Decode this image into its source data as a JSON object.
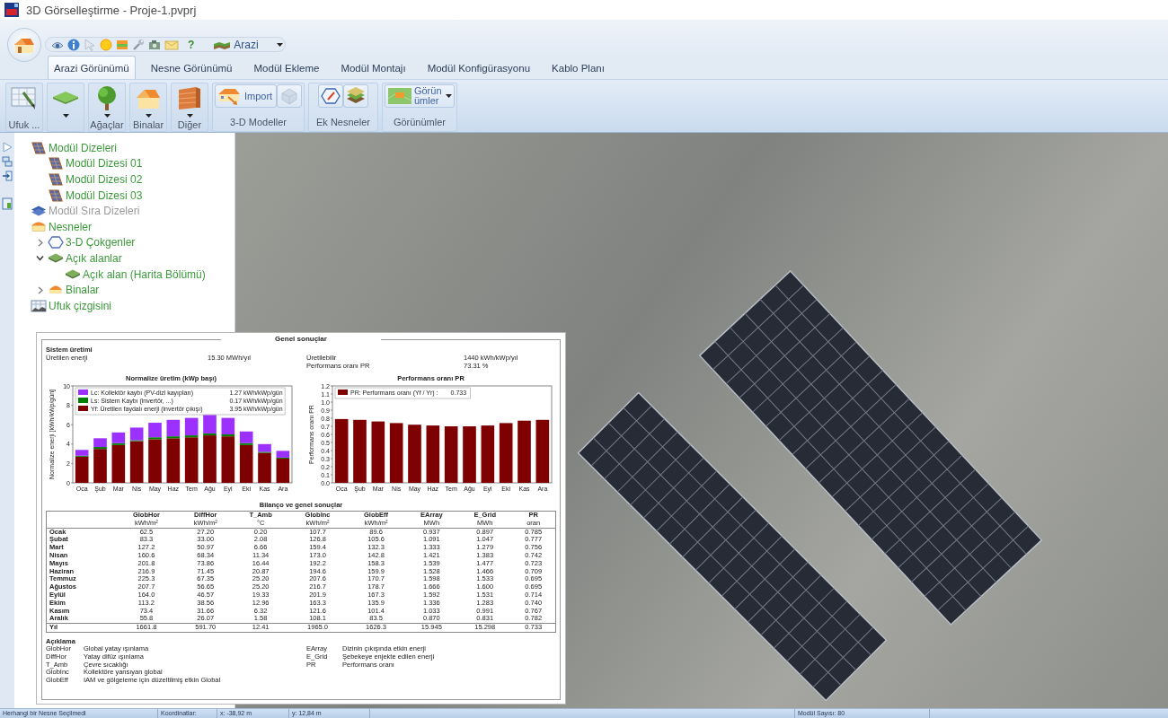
{
  "window": {
    "title": "3D Görselleştirme - Proje-1.pvprj"
  },
  "quick_access": {
    "help": "?",
    "view_dropdown": "Arazi"
  },
  "tabs": [
    {
      "label": "Arazi Görünümü",
      "selected": true
    },
    {
      "label": "Nesne Görünümü",
      "selected": false
    },
    {
      "label": "Modül Ekleme",
      "selected": false
    },
    {
      "label": "Modül Montajı",
      "selected": false
    },
    {
      "label": "Modül Konfigürasyonu",
      "selected": false
    },
    {
      "label": "Kablo Planı",
      "selected": false
    }
  ],
  "ribbon": {
    "buttons": [
      {
        "kind": "horizon",
        "label": "Ufuk ...",
        "dropdown": false
      },
      {
        "kind": "ground",
        "dropdown": true
      },
      {
        "kind": "tree",
        "label": "Ağaçlar",
        "dropdown": true
      },
      {
        "kind": "house",
        "label": "Binalar",
        "dropdown": true
      },
      {
        "kind": "wall",
        "label": "Diğer",
        "dropdown": true
      }
    ],
    "groups": [
      {
        "label": "3-D Modeller",
        "buttons": [
          {
            "kind": "import",
            "label": "Import",
            "disabled": false,
            "dropdown": false
          },
          {
            "kind": "mesh",
            "disabled": true,
            "dropdown": false
          }
        ]
      },
      {
        "label": "Ek Nesneler",
        "buttons": [
          {
            "kind": "polygon",
            "disabled": false,
            "dropdown": false
          },
          {
            "kind": "layers",
            "disabled": false,
            "dropdown": false
          }
        ]
      },
      {
        "label": "Görünümler",
        "buttons": [
          {
            "kind": "views",
            "label": "Görünümler",
            "disabled": false,
            "dropdown": true
          }
        ]
      }
    ]
  },
  "tree": [
    {
      "kind": "modules",
      "label": "Modül Dizeleri",
      "disabled": false,
      "children": [
        {
          "kind": "modules",
          "label": "Modül Dizesi 01",
          "disabled": false
        },
        {
          "kind": "modules",
          "label": "Modül Dizesi 02",
          "disabled": false
        },
        {
          "kind": "modules",
          "label": "Modül Dizesi 03",
          "disabled": false
        }
      ]
    },
    {
      "kind": "module_rows",
      "label": "Modül Sıra Dizeleri",
      "disabled": true
    },
    {
      "kind": "objects",
      "label": "Nesneler",
      "disabled": false,
      "children": [
        {
          "kind": "polygons",
          "label": "3-D Çokgenler",
          "disabled": false,
          "expanded": false
        },
        {
          "kind": "open_area",
          "label": "Açık alanlar",
          "disabled": false,
          "expanded": true,
          "children": [
            {
              "kind": "open_area",
              "label": "Açık alan (Harita Bölümü)",
              "disabled": false
            }
          ]
        },
        {
          "kind": "buildings",
          "label": "Binalar",
          "disabled": false,
          "expanded": false
        }
      ]
    },
    {
      "kind": "horizon",
      "label": "Ufuk çizgisini",
      "disabled": false
    }
  ],
  "report": {
    "title": "Genel sonuçlar",
    "summary": {
      "title": "Sistem üretimi",
      "left": [
        {
          "label": "Üretilen enerji",
          "value": "15.30 MWh/yıl"
        }
      ],
      "right": [
        {
          "label": "Üretilebilir",
          "value": "1440 kWh/kWp/yıl"
        },
        {
          "label": "Performans oranı PR",
          "value": "73.31 %"
        }
      ]
    },
    "charts": [
      {
        "legend_values": [
          "1.27 kWh/kWp/gün",
          "0.17 kWh/kWp/gün",
          "3.95 kWh/kWp/gün"
        ],
        "chart_data": {
          "type": "bar",
          "title": "Normalize üretim (kWp başı)",
          "ylabel": "Normalize enerji [kWh/kWp/gün]",
          "categories": [
            "Oca",
            "Şub",
            "Mar",
            "Nis",
            "May",
            "Haz",
            "Tem",
            "Ağu",
            "Eyl",
            "Eki",
            "Kas",
            "Ara"
          ],
          "series": [
            {
              "name": "Yf: Üretilen faydalı enerji (invertör çıkışı)",
              "color": "#7f0000",
              "values": [
                2.7,
                3.5,
                3.9,
                4.3,
                4.5,
                4.6,
                4.7,
                4.9,
                4.8,
                3.9,
                3.1,
                2.5
              ]
            },
            {
              "name": "Ls: Sistem Kaybı (invertör, ...)",
              "color": "#008000",
              "values": [
                0.1,
                0.2,
                0.2,
                0.1,
                0.2,
                0.2,
                0.2,
                0.2,
                0.2,
                0.2,
                0.1,
                0.1
              ]
            },
            {
              "name": "Lc: Kollektör kaybı (PV-dizi kayıpları)",
              "color": "#9b30ff",
              "values": [
                0.6,
                0.9,
                1.1,
                1.3,
                1.5,
                1.7,
                1.8,
                1.9,
                1.7,
                1.2,
                0.8,
                0.7
              ]
            }
          ],
          "ylim": [
            0,
            10
          ],
          "yticks": [
            0,
            2,
            4,
            6,
            8,
            10
          ],
          "stacked": true,
          "legend": "upper left"
        }
      },
      {
        "legend_values": [
          "0.733"
        ],
        "chart_data": {
          "type": "bar",
          "title": "Performans oranı PR",
          "ylabel": "Performans oranı PR",
          "categories": [
            "Oca",
            "Şub",
            "Mar",
            "Nis",
            "May",
            "Haz",
            "Tem",
            "Ağu",
            "Eyl",
            "Eki",
            "Kas",
            "Ara"
          ],
          "series": [
            {
              "name": "PR: Performans oranı (Yf / Yr) :",
              "color": "#7f0000",
              "values": [
                0.79,
                0.78,
                0.76,
                0.74,
                0.72,
                0.71,
                0.7,
                0.7,
                0.71,
                0.74,
                0.77,
                0.78
              ]
            }
          ],
          "ylim": [
            0,
            1.2
          ],
          "yticks": [
            {
              "value": 0,
              "label": "0.0"
            },
            0.1,
            0.2,
            0.3,
            0.4,
            0.5,
            0.6,
            0.7,
            0.8,
            0.9,
            {
              "value": 1,
              "label": "1.0"
            },
            1.1,
            1.2
          ],
          "legend": "upper left"
        }
      }
    ],
    "table": {
      "title": "Bilanço ve genel sonuçlar",
      "columns": [
        {
          "name": "GlobHor",
          "unit": "kWh/m²"
        },
        {
          "name": "DiffHor",
          "unit": "kWh/m²"
        },
        {
          "name": "T_Amb",
          "unit": "°C"
        },
        {
          "name": "GlobInc",
          "unit": "kWh/m²"
        },
        {
          "name": "GlobEff",
          "unit": "kWh/m²"
        },
        {
          "name": "EArray",
          "unit": "MWh"
        },
        {
          "name": "E_Grid",
          "unit": "MWh"
        },
        {
          "name": "PR",
          "unit": "oran"
        }
      ],
      "rows": [
        {
          "label": "Ocak",
          "cells": [
            "62.5",
            "27.20",
            "0.20",
            "107.7",
            "89.6",
            "0.937",
            "0.897",
            "0.785"
          ]
        },
        {
          "label": "Şubat",
          "cells": [
            "83.3",
            "33.00",
            "2.08",
            "126.8",
            "105.6",
            "1.091",
            "1.047",
            "0.777"
          ]
        },
        {
          "label": "Mart",
          "cells": [
            "127.2",
            "50.97",
            "6.66",
            "159.4",
            "132.3",
            "1.333",
            "1.279",
            "0.756"
          ]
        },
        {
          "label": "Nisan",
          "cells": [
            "160.6",
            "68.34",
            "11.34",
            "173.0",
            "142.8",
            "1.421",
            "1.383",
            "0.742"
          ]
        },
        {
          "label": "Mayıs",
          "cells": [
            "201.8",
            "73.86",
            "16.44",
            "192.2",
            "158.3",
            "1.539",
            "1.477",
            "0.723"
          ]
        },
        {
          "label": "Haziran",
          "cells": [
            "216.9",
            "71.45",
            "20.87",
            "194.6",
            "159.9",
            "1.528",
            "1.466",
            "0.709"
          ]
        },
        {
          "label": "Temmuz",
          "cells": [
            "225.3",
            "67.35",
            "25.20",
            "207.6",
            "170.7",
            "1.598",
            "1.533",
            "0.695"
          ]
        },
        {
          "label": "Ağustos",
          "cells": [
            "207.7",
            "56.65",
            "25.20",
            "216.7",
            "178.7",
            "1.666",
            "1.600",
            "0.695"
          ]
        },
        {
          "label": "Eylül",
          "cells": [
            "164.0",
            "46.57",
            "19.33",
            "201.9",
            "167.3",
            "1.592",
            "1.531",
            "0.714"
          ]
        },
        {
          "label": "Ekim",
          "cells": [
            "113.2",
            "38.56",
            "12.96",
            "163.3",
            "135.9",
            "1.336",
            "1.283",
            "0.740"
          ]
        },
        {
          "label": "Kasım",
          "cells": [
            "73.4",
            "31.66",
            "6.32",
            "121.6",
            "101.4",
            "1.033",
            "0.991",
            "0.767"
          ]
        },
        {
          "label": "Aralık",
          "cells": [
            "55.8",
            "26.07",
            "1.58",
            "108.1",
            "83.5",
            "0.870",
            "0.831",
            "0.782"
          ]
        }
      ],
      "total": {
        "label": "Yıl",
        "cells": [
          "1661.8",
          "591.70",
          "12.41",
          "1965.0",
          "1626.3",
          "15.945",
          "15.298",
          "0.733"
        ]
      }
    },
    "glossary": {
      "title": "Açıklama",
      "left": [
        {
          "term": "GlobHor",
          "text": "Global yatay ışınlama"
        },
        {
          "term": "DiffHor",
          "text": "Yatay difüz ışınlama"
        },
        {
          "term": "T_Amb",
          "text": "Çevre sıcaklığı"
        },
        {
          "term": "GlobInc",
          "text": "Kollektöre yansıyan global"
        },
        {
          "term": "GlobEff",
          "text": "IAM ve gölgeleme için düzeltilmiş etkin Global"
        }
      ],
      "right": [
        {
          "term": "EArray",
          "text": "Dizinin çıkışında etkin enerji"
        },
        {
          "term": "E_Grid",
          "text": "Şebekeye enjekte edilen enerji"
        },
        {
          "term": "PR",
          "text": "Performans oranı"
        }
      ]
    }
  },
  "status_bar": {
    "selection": "Herhangi bir Nesne Seçilmedi",
    "coords_label": "Koordinatlar:",
    "x": "x: -38,92 m",
    "y": "y: 12,84 m",
    "module_count": "Modül Sayısı: 80"
  }
}
